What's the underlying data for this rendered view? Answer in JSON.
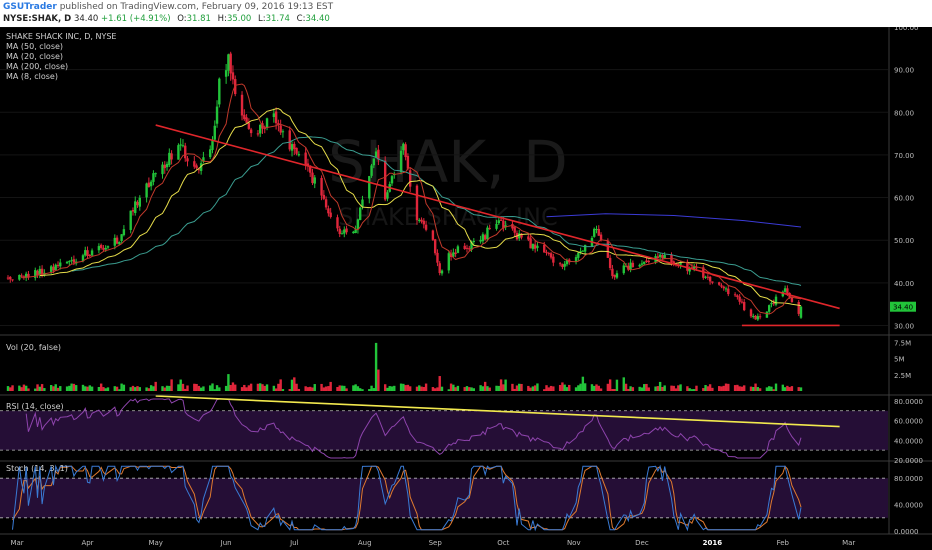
{
  "header": {
    "author": "GSUTrader",
    "published": "published on TradingView.com, February 09, 2016 19:13 EST",
    "symbol": "NYSE:SHAK, D",
    "last": "34.40",
    "change": "+1.61 (+4.91%)",
    "o_label": "O:",
    "o_value": "31.81",
    "h_label": "H:",
    "h_value": "35.00",
    "l_label": "L:",
    "l_value": "31.74",
    "c_label": "C:",
    "c_value": "34.40"
  },
  "main_legend": {
    "title": "SHAKE SHACK INC, D, NYSE",
    "ma_labels": [
      "MA (50, close)",
      "MA (20, close)",
      "MA (200, close)",
      "MA (8, close)"
    ]
  },
  "watermark": {
    "ticker": "SHAK, D",
    "name": "SHAKE SHACK INC"
  },
  "panels": {
    "vol_label": "Vol (20, false)",
    "rsi_label": "RSI (14, close)",
    "stoch_label": "Stoch (14, 3, 1)"
  },
  "price_badge": "34.40",
  "colors": {
    "background": "#000000",
    "up": "#22c43a",
    "down": "#e0263b",
    "trendline": "#e0262b",
    "support": "#e0262b",
    "rsi_trend": "#f2e94e",
    "rsi_line": "#8e44ad",
    "stoch_k": "#3a7bd5",
    "stoch_d": "#e07a2f",
    "ma50": "#3a9c8f",
    "ma20": "#e6dc4a",
    "ma200": "#3b3bd6",
    "ma8": "#c0392b"
  },
  "chart_data": [
    {
      "type": "candlestick",
      "title": "SHAKE SHACK INC, D, NYSE",
      "x_ticks": [
        "Mar",
        "Apr",
        "May",
        "Jun",
        "Jul",
        "Aug",
        "Sep",
        "Oct",
        "Nov",
        "Dec",
        "2016",
        "Feb",
        "Mar"
      ],
      "y_ticks": [
        "100.00",
        "90.00",
        "80.00",
        "70.00",
        "60.00",
        "50.00",
        "40.00",
        "30.00"
      ],
      "ylim": [
        28,
        100
      ],
      "anchors": [
        {
          "date": "2015-02-25",
          "close": 41
        },
        {
          "date": "2015-03-15",
          "close": 43
        },
        {
          "date": "2015-04-01",
          "close": 47
        },
        {
          "date": "2015-04-15",
          "close": 50
        },
        {
          "date": "2015-04-22",
          "close": 58
        },
        {
          "date": "2015-05-01",
          "close": 66
        },
        {
          "date": "2015-05-12",
          "close": 72
        },
        {
          "date": "2015-05-20",
          "close": 66
        },
        {
          "date": "2015-05-26",
          "close": 72
        },
        {
          "date": "2015-05-29",
          "close": 86
        },
        {
          "date": "2015-06-02",
          "close": 92
        },
        {
          "date": "2015-06-08",
          "close": 78
        },
        {
          "date": "2015-06-15",
          "close": 75
        },
        {
          "date": "2015-06-23",
          "close": 79
        },
        {
          "date": "2015-07-01",
          "close": 70
        },
        {
          "date": "2015-07-10",
          "close": 64
        },
        {
          "date": "2015-07-20",
          "close": 52
        },
        {
          "date": "2015-07-27",
          "close": 51
        },
        {
          "date": "2015-08-03",
          "close": 66
        },
        {
          "date": "2015-08-06",
          "close": 70
        },
        {
          "date": "2015-08-10",
          "close": 60
        },
        {
          "date": "2015-08-18",
          "close": 72
        },
        {
          "date": "2015-08-24",
          "close": 55
        },
        {
          "date": "2015-08-31",
          "close": 50
        },
        {
          "date": "2015-09-03",
          "close": 43
        },
        {
          "date": "2015-09-08",
          "close": 47
        },
        {
          "date": "2015-09-21",
          "close": 50
        },
        {
          "date": "2015-09-29",
          "close": 55
        },
        {
          "date": "2015-10-09",
          "close": 50
        },
        {
          "date": "2015-10-20",
          "close": 47
        },
        {
          "date": "2015-10-26",
          "close": 44
        },
        {
          "date": "2015-11-03",
          "close": 46
        },
        {
          "date": "2015-11-11",
          "close": 53
        },
        {
          "date": "2015-11-18",
          "close": 42
        },
        {
          "date": "2015-11-27",
          "close": 44
        },
        {
          "date": "2015-12-10",
          "close": 46
        },
        {
          "date": "2015-12-24",
          "close": 43
        },
        {
          "date": "2016-01-05",
          "close": 39
        },
        {
          "date": "2016-01-12",
          "close": 36
        },
        {
          "date": "2016-01-20",
          "close": 31
        },
        {
          "date": "2016-01-27",
          "close": 35
        },
        {
          "date": "2016-02-02",
          "close": 38
        },
        {
          "date": "2016-02-08",
          "close": 33
        },
        {
          "date": "2016-02-09",
          "close": 34.4
        }
      ],
      "ma200": [
        {
          "date": "2015-10-20",
          "value": 55.5
        },
        {
          "date": "2015-11-15",
          "value": 56.2
        },
        {
          "date": "2015-12-15",
          "value": 55.8
        },
        {
          "date": "2016-01-15",
          "value": 54.6
        },
        {
          "date": "2016-02-09",
          "value": 53.1
        }
      ],
      "trendline": [
        {
          "date": "2015-05-01",
          "value": 77
        },
        {
          "date": "2016-02-26",
          "value": 34
        }
      ],
      "support": [
        {
          "date": "2016-01-14",
          "value": 30
        },
        {
          "date": "2016-02-26",
          "value": 30
        }
      ]
    },
    {
      "type": "bar",
      "title": "Vol (20, false)",
      "y_ticks": [
        "7.5M",
        "5M",
        "2.5M"
      ],
      "ylim": [
        0,
        8000000
      ],
      "spikes": [
        {
          "date": "2015-08-06",
          "value": 7400000
        },
        {
          "date": "2015-08-07",
          "value": 3300000
        },
        {
          "date": "2015-06-02",
          "value": 2600000
        },
        {
          "date": "2015-11-05",
          "value": 2200000
        },
        {
          "date": "2015-09-03",
          "value": 2300000
        }
      ]
    },
    {
      "type": "line",
      "title": "RSI (14, close)",
      "y_ticks": [
        "80.0000",
        "60.0000",
        "40.0000",
        "20.0000"
      ],
      "ylim": [
        20,
        85
      ],
      "bands": [
        70,
        30
      ],
      "trendline": [
        {
          "date": "2015-05-01",
          "value": 85
        },
        {
          "date": "2016-02-26",
          "value": 54
        }
      ]
    },
    {
      "type": "line",
      "title": "Stoch (14, 3, 1)",
      "y_ticks": [
        "80.0000",
        "40.0000",
        "0.0000"
      ],
      "ylim": [
        0,
        100
      ],
      "bands": [
        80,
        20
      ]
    }
  ]
}
